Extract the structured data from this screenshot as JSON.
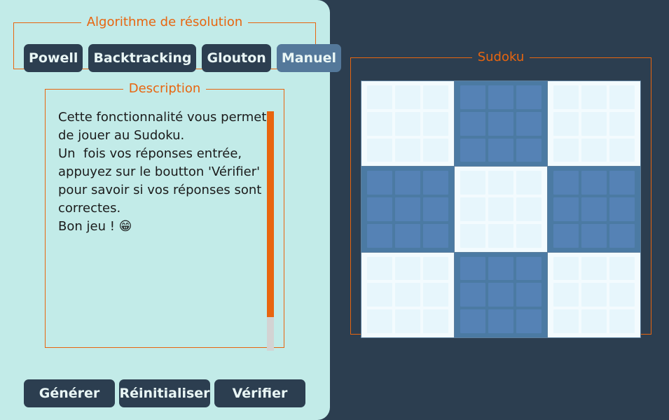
{
  "algorithm": {
    "legend": "Algorithme de résolution",
    "buttons": [
      "Powell",
      "Backtracking",
      "Glouton",
      "Manuel"
    ],
    "selected": "Manuel"
  },
  "description": {
    "legend": "Description",
    "text": "Cette fonctionnalité vous permet de jouer au Sudoku.\nUn  fois vos réponses entrée, appuyez sur le boutton 'Vérifier' pour savoir si vos réponses sont correctes.\nBon jeu ! 😁"
  },
  "actions": {
    "generate_label": "Générer",
    "reset_label": "Réinitialiser",
    "verify_label": "Vérifier"
  },
  "sudoku": {
    "legend": "Sudoku",
    "box_shades": [
      "light",
      "dark",
      "light",
      "dark",
      "light",
      "dark",
      "light",
      "dark",
      "light"
    ]
  },
  "colors": {
    "accent": "#e8650f",
    "panel_bg": "#c2ebe8",
    "app_bg": "#2c3e50",
    "button_bg": "#2c3e50",
    "button_selected_bg": "#54789a"
  }
}
